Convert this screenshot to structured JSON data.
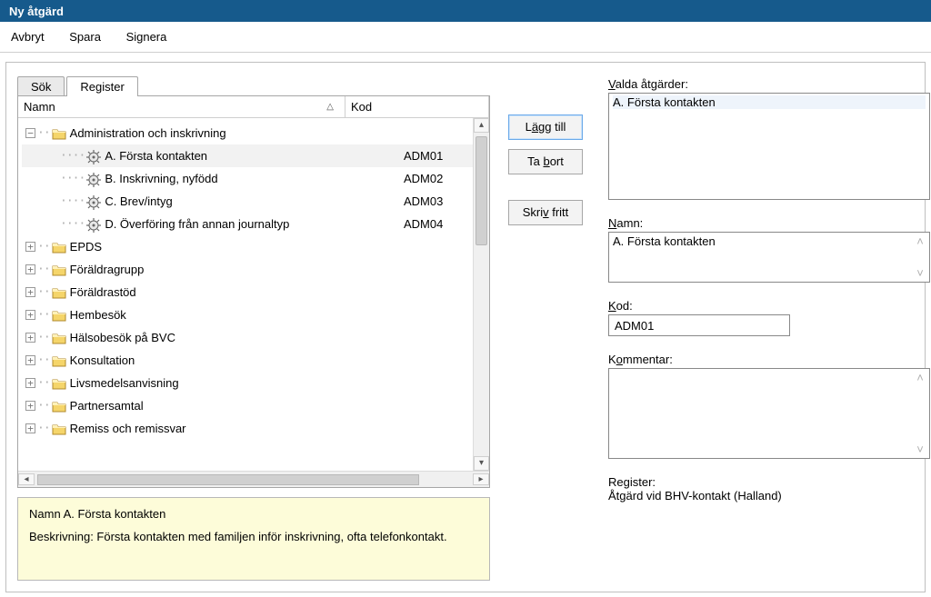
{
  "window": {
    "title": "Ny åtgärd"
  },
  "menubar": {
    "cancel": "Avbryt",
    "save": "Spara",
    "sign": "Signera"
  },
  "tabs": {
    "search": "Sök",
    "register": "Register"
  },
  "tree": {
    "headers": {
      "name": "Namn",
      "code": "Kod"
    },
    "expanded": {
      "label": "Administration och inskrivning",
      "children": [
        {
          "label": "A. Första kontakten",
          "code": "ADM01"
        },
        {
          "label": "B. Inskrivning, nyfödd",
          "code": "ADM02"
        },
        {
          "label": "C. Brev/intyg",
          "code": "ADM03"
        },
        {
          "label": "D. Överföring från annan journaltyp",
          "code": "ADM04"
        }
      ]
    },
    "collapsed": [
      "EPDS",
      "Föräldragrupp",
      "Föräldrastöd",
      "Hembesök",
      "Hälsobesök på BVC",
      "Konsultation",
      "Livsmedelsanvisning",
      "Partnersamtal",
      "Remiss och remissvar"
    ]
  },
  "description": {
    "line1": "Namn A. Första kontakten",
    "line2": "Beskrivning: Första kontakten med familjen inför inskrivning, ofta telefonkontakt."
  },
  "buttons": {
    "add_pre": "L",
    "add_mn": "ä",
    "add_post": "gg till",
    "remove_pre": "Ta ",
    "remove_mn": "b",
    "remove_post": "ort",
    "free_pre": "Skri",
    "free_mn": "v",
    "free_post": " fritt"
  },
  "labels": {
    "selected_pre": "",
    "selected_mn": "V",
    "selected_post": "alda åtgärder:",
    "name_pre": "",
    "name_mn": "N",
    "name_post": "amn:",
    "code_pre": "",
    "code_mn": "K",
    "code_post": "od:",
    "comment_pre": "K",
    "comment_mn": "o",
    "comment_post": "mmentar:",
    "register": "Register:"
  },
  "fields": {
    "selected_item": "A. Första kontakten",
    "name_value": "A. Första kontakten",
    "code_value": "ADM01",
    "comment_value": "",
    "register_value": "Åtgärd vid BHV-kontakt (Halland)"
  }
}
